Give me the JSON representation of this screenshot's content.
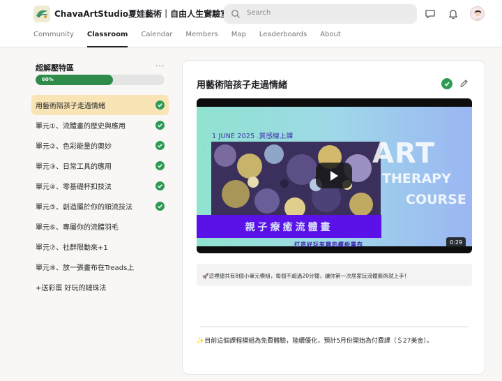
{
  "header": {
    "brand": "ChavaArtStudio夏娃藝術｜自由人生實驗室",
    "switcher": "⌃⌄",
    "search_placeholder": "Search",
    "tabs": [
      "Community",
      "Classroom",
      "Calendar",
      "Members",
      "Map",
      "Leaderboards",
      "About"
    ],
    "active_tab": "Classroom"
  },
  "sidebar": {
    "course_title": "超解壓特區",
    "more": "···",
    "progress_percent": 60,
    "progress_label": "60%",
    "lessons": [
      {
        "label": "用藝術陪孩子走過情緒",
        "completed": true,
        "active": true
      },
      {
        "label": "單元①、流體畫的歷史與應用",
        "completed": true,
        "active": false
      },
      {
        "label": "單元②、色彩能量的奧妙",
        "completed": true,
        "active": false
      },
      {
        "label": "單元③、日常工具的應用",
        "completed": true,
        "active": false
      },
      {
        "label": "單元④、零基礎杯扣技法",
        "completed": true,
        "active": false
      },
      {
        "label": "單元⑤、創造屬於你的順流技法",
        "completed": true,
        "active": false
      },
      {
        "label": "單元⑥、專屬你的流體羽毛",
        "completed": false,
        "active": false
      },
      {
        "label": "單元⑦、社群限動來+1",
        "completed": false,
        "active": false
      },
      {
        "label": "單元⑧、放一張畫布在Treads上",
        "completed": false,
        "active": false
      },
      {
        "label": "+送彩蛋 好玩的鏈珠法",
        "completed": false,
        "active": false
      }
    ]
  },
  "lesson": {
    "title": "用藝術陪孩子走過情緒",
    "video": {
      "date_text": "1 JUNE 2025 .質感線上課",
      "art_line1": "ART",
      "art_line2": "THERAPY",
      "art_line3": "COURSE",
      "banner": "親子療癒流體畫",
      "subtitle": "打造好玩有趣的繽紛畫布",
      "duration": "0:29"
    },
    "note": "🚀這裡總共有8個小單元模組，每個不超過20分鐘，讓你第一次居家玩流體藝術就上手！",
    "footer": "✨目前這個課程模組為免費體驗，陸續優化，預計5月份開始為付費課（＄27美金）。"
  },
  "colors": {
    "accent_green": "#2e9b55",
    "active_lesson_bg": "#f8e4b4",
    "banner_purple": "#5a12e8"
  }
}
